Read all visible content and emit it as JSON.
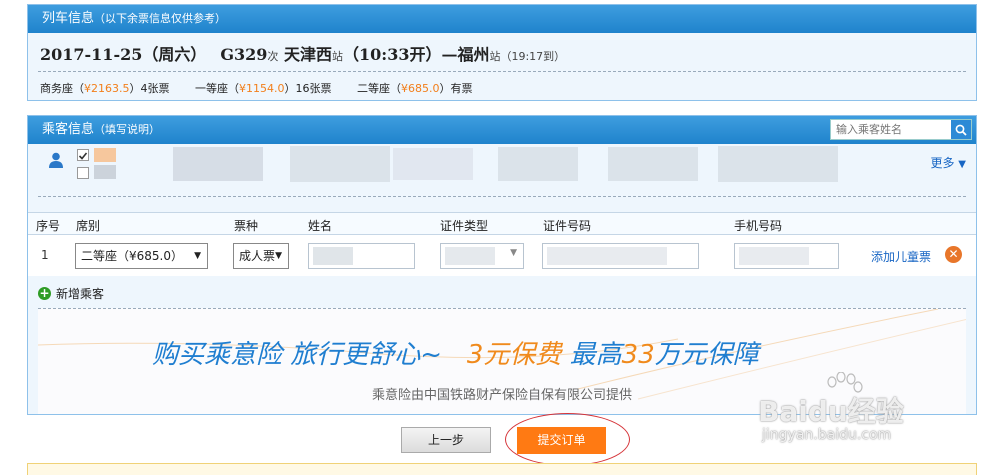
{
  "train_panel": {
    "title": "列车信息",
    "note": "（以下余票信息仅供参考）",
    "date": "2017-11-25（周六）",
    "train_no": "G329",
    "train_suffix": "次",
    "from_station": "天津西",
    "station_suffix": "站",
    "depart": "（10:33开）",
    "arrow": "—",
    "to_station": "福州",
    "arrive": "（19:17到）",
    "seats": [
      {
        "name": "商务座（",
        "price": "¥2163.5",
        "rest": "）4张票"
      },
      {
        "name": "一等座（",
        "price": "¥1154.0",
        "rest": "）16张票"
      },
      {
        "name": "二等座（",
        "price": "¥685.0",
        "rest": "）有票"
      }
    ]
  },
  "passenger_panel": {
    "title": "乘客信息",
    "note": "（填写说明）",
    "search_placeholder": "输入乘客姓名",
    "more": "更多",
    "table_headers": {
      "seq": "序号",
      "seat": "席别",
      "ticket": "票种",
      "name": "姓名",
      "id_type": "证件类型",
      "id_no": "证件号码",
      "phone": "手机号码"
    },
    "row": {
      "seq": "1",
      "seat_value": "二等座（¥685.0）",
      "ticket_value": "成人票",
      "add_child": "添加儿童票"
    },
    "add_passenger": "新增乘客"
  },
  "insurance": {
    "slogan_part1": "购买乘意险  旅行更舒心~",
    "slogan_part2": "3元保费",
    "slogan_part3": "  最高",
    "slogan_part4": "33",
    "slogan_part5": "万元保障",
    "provider": "乘意险由中国铁路财产保险自保有限公司提供"
  },
  "actions": {
    "prev": "上一步",
    "submit": "提交订单"
  },
  "watermark": {
    "brand": "Baidu经验",
    "url": "jingyan.baidu.com"
  },
  "colors": {
    "header_blue": "#1f83cc",
    "price_orange": "#f27f1b",
    "submit_orange": "#ff7a13",
    "link_blue": "#1866c4",
    "highlight_red": "#d6353a"
  }
}
